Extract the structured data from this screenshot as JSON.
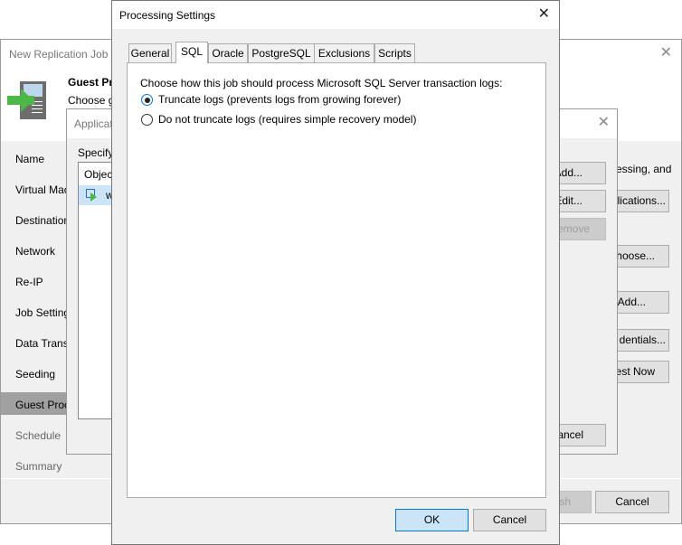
{
  "replication_job": {
    "title": "New Replication Job",
    "header_title": "Guest Pro",
    "header_desc": "Choose g",
    "nav": [
      "Name",
      "Virtual Mac",
      "Destination",
      "Network",
      "Re-IP",
      "Job Setting",
      "Data Transf",
      "Seeding",
      "Guest Proc",
      "Schedule",
      "Summary"
    ],
    "right_text": "essing, and",
    "buttons": {
      "applications": "plications...",
      "choose": "hoose...",
      "add": "Add...",
      "credentials": "dentials...",
      "test_now": "est Now",
      "finish": "sh",
      "cancel": "Cancel"
    }
  },
  "app_dialog": {
    "title": "Applicat",
    "specify": "Specify",
    "list_header": "Objec",
    "list_row": "w",
    "buttons": {
      "add": "Add...",
      "edit": "Edit...",
      "remove": "emove",
      "cancel": "ancel"
    }
  },
  "processing": {
    "title": "Processing Settings",
    "tabs": [
      "General",
      "SQL",
      "Oracle",
      "PostgreSQL",
      "Exclusions",
      "Scripts"
    ],
    "active_tab": "SQL",
    "prompt": "Choose how this job should process Microsoft SQL Server transaction logs:",
    "options": [
      {
        "label": "Truncate logs (prevents logs from growing forever)",
        "selected": true
      },
      {
        "label": "Do not truncate logs (requires simple recovery model)",
        "selected": false
      }
    ],
    "ok": "OK",
    "cancel": "Cancel"
  }
}
